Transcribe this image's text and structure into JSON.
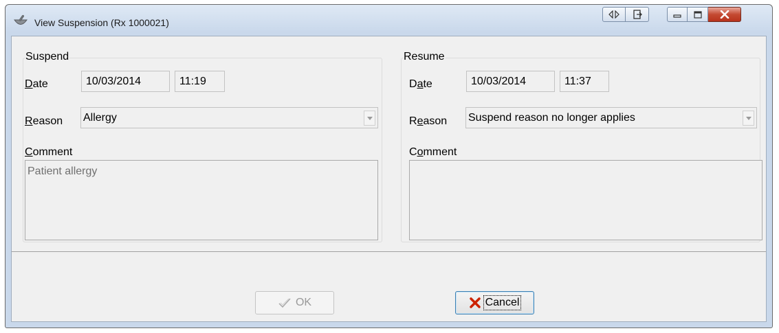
{
  "window": {
    "title": "View Suspension (Rx 1000021)"
  },
  "suspend": {
    "legend": "Suspend",
    "date_label": {
      "before": "",
      "key": "D",
      "after": "ate"
    },
    "date": "10/03/2014",
    "time": "11:19",
    "reason_label": {
      "before": "",
      "key": "R",
      "after": "eason"
    },
    "reason": "Allergy",
    "comment_label": {
      "before": "",
      "key": "C",
      "after": "omment"
    },
    "comment": "Patient allergy"
  },
  "resume": {
    "legend": "Resume",
    "date_label": {
      "before": "D",
      "key": "a",
      "after": "te"
    },
    "date": "10/03/2014",
    "time": "11:37",
    "reason_label": {
      "before": "R",
      "key": "e",
      "after": "ason"
    },
    "reason": "Suspend reason no longer applies",
    "comment_label": {
      "before": "C",
      "key": "o",
      "after": "mment"
    },
    "comment": ""
  },
  "buttons": {
    "ok": "OK",
    "cancel": "Cancel"
  },
  "icons": {
    "app": "mortar-pestle-icon",
    "nav": "left-right-arrows-icon",
    "export": "export-icon",
    "minimize": "minimize-icon",
    "maximize": "maximize-icon",
    "close": "close-icon",
    "ok": "checkmark-icon",
    "cancel": "red-x-icon"
  },
  "colors": {
    "cancel_x": "#cc2200",
    "close_button": "#c44a32"
  }
}
